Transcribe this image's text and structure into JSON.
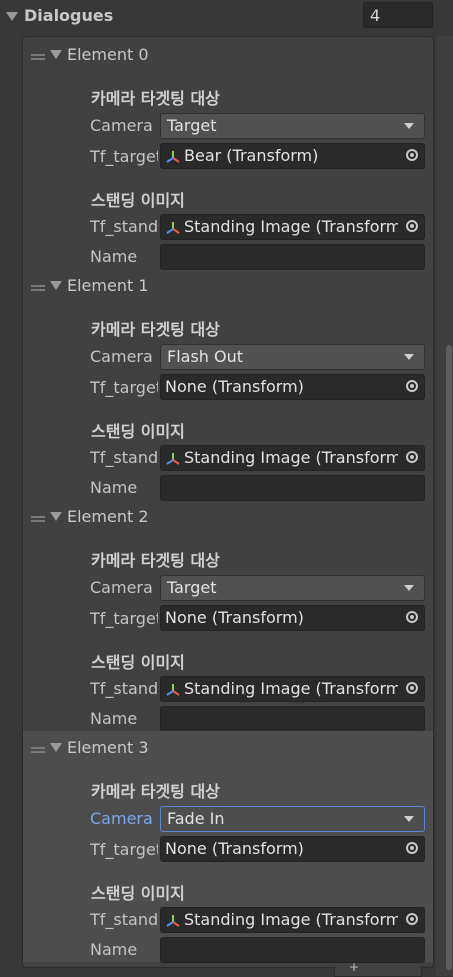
{
  "header": {
    "title": "Dialogues",
    "count": "4"
  },
  "section_titles": {
    "camera": "카메라 타겟팅 대상",
    "standing": "스탠딩 이미지"
  },
  "labels": {
    "camera": "Camera",
    "tf_target": "Tf_target",
    "tf_standing": "Tf_standing",
    "name": "Name"
  },
  "elements": [
    {
      "title": "Element 0",
      "camera_value": "Target",
      "tf_target_value": "Bear (Transform)",
      "tf_target_icon": true,
      "tf_standing_value": "Standing Image (Transform)",
      "name_value": ""
    },
    {
      "title": "Element 1",
      "camera_value": "Flash Out",
      "tf_target_value": "None (Transform)",
      "tf_target_icon": false,
      "tf_standing_value": "Standing Image (Transform)",
      "name_value": ""
    },
    {
      "title": "Element 2",
      "camera_value": "Target",
      "tf_target_value": "None (Transform)",
      "tf_target_icon": false,
      "tf_standing_value": "Standing Image (Transform)",
      "name_value": ""
    },
    {
      "title": "Element 3",
      "camera_value": "Fade In",
      "tf_target_value": "None (Transform)",
      "tf_target_icon": false,
      "tf_standing_value": "Standing Image (Transform)",
      "name_value": "",
      "selected": true
    }
  ],
  "icons": {
    "transform": "transform-gizmo-icon",
    "picker": "object-picker-icon",
    "foldout": "foldout-arrow-icon",
    "drag": "drag-handle-icon",
    "add": "plus-icon"
  },
  "footer": {
    "add_symbol": "+"
  },
  "colors": {
    "background": "#383838",
    "accent_label": "#7aa6ea",
    "focus_border": "#5a86d4"
  }
}
